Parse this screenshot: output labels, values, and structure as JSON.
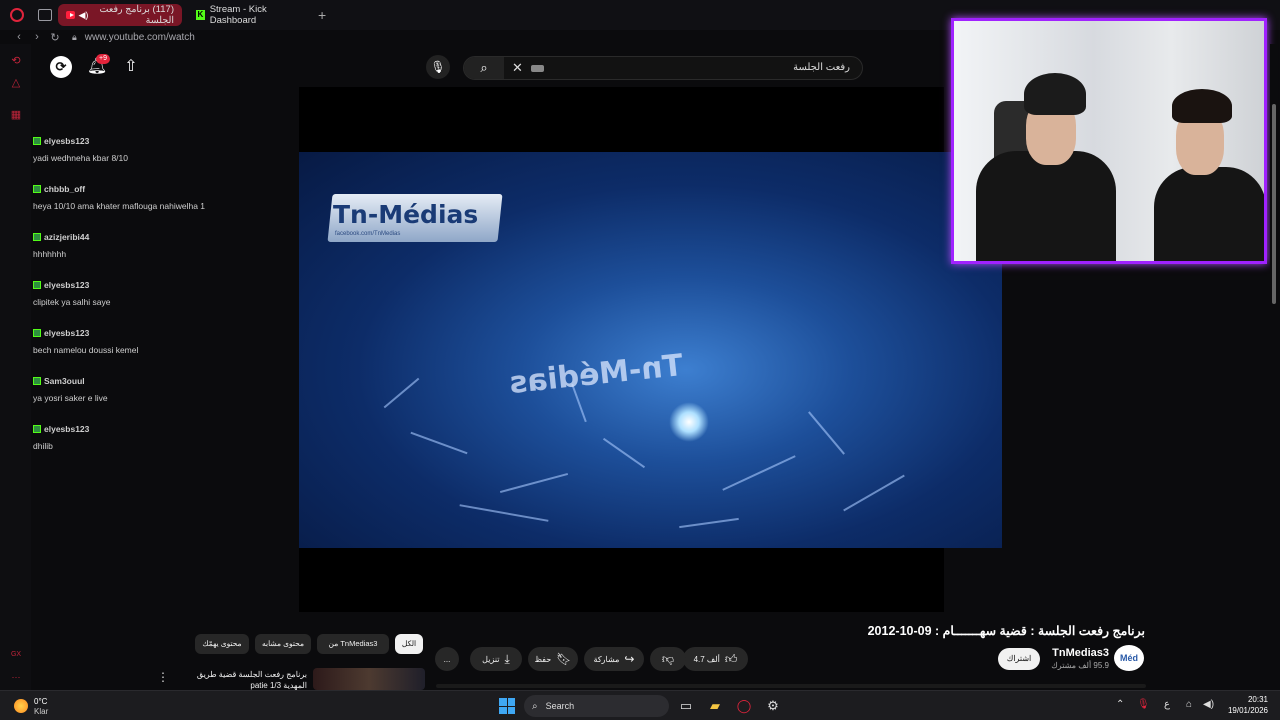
{
  "browser": {
    "tabs": [
      {
        "label": "(117) برنامج رفعت الجلسة",
        "active": true,
        "favicon": "youtube-icon"
      },
      {
        "label": "Stream - Kick Dashboard",
        "active": false,
        "favicon": "kick-icon"
      }
    ],
    "new_tab_label": "+",
    "url": "www.youtube.com/watch"
  },
  "youtube": {
    "header": {
      "notification_count": "+9",
      "search_query": "رفعت الجلسة"
    },
    "video": {
      "title": "برنامج رفعت الجلسة : قضية سهـــــــام : 09-10-2012",
      "watermark": "Tn-Médias",
      "watermark_sub": "facebook.com/TnMedias",
      "mirrored_text": "Tn-Médias"
    },
    "channel": {
      "name": "TnMedias3",
      "subscribers": "95.9 ألف مشترك",
      "avatar_text": "Méd",
      "subscribe_label": "اشتراك"
    },
    "actions": {
      "likes": "4.7 ألف",
      "share": "مشاركة",
      "save": "حفظ",
      "download": "تنزيل",
      "more": "..."
    },
    "chips": [
      "الكل",
      "من TnMedias3",
      "محتوى مشابه",
      "محتوى يهمّك"
    ],
    "recommendation": {
      "title": "برنامج رفعت الجلسة قضية طريق المهدية patie 1/3"
    }
  },
  "chat": [
    {
      "user": "elyesbs123",
      "message": "yadi wedhneha kbar 8/10"
    },
    {
      "user": "chbbb_off",
      "message": "heya 10/10 ama khater maflouga nahiwelha 1"
    },
    {
      "user": "azizjeribi44",
      "message": "hhhhhhh"
    },
    {
      "user": "elyesbs123",
      "message": "clipitek ya salhi saye"
    },
    {
      "user": "elyesbs123",
      "message": "bech namelou doussi kemel"
    },
    {
      "user": "Sam3ouul",
      "message": "ya yosri saker e live"
    },
    {
      "user": "elyesbs123",
      "message": "dhilib"
    }
  ],
  "taskbar": {
    "weather_temp": "0°C",
    "weather_desc": "Klar",
    "search_label": "Search",
    "time": "20:31",
    "date": "19/01/2026",
    "lang": "ع"
  },
  "colors": {
    "accent_red": "#e0243c",
    "webcam_border": "#a022ff",
    "kick_green": "#53fc18"
  }
}
